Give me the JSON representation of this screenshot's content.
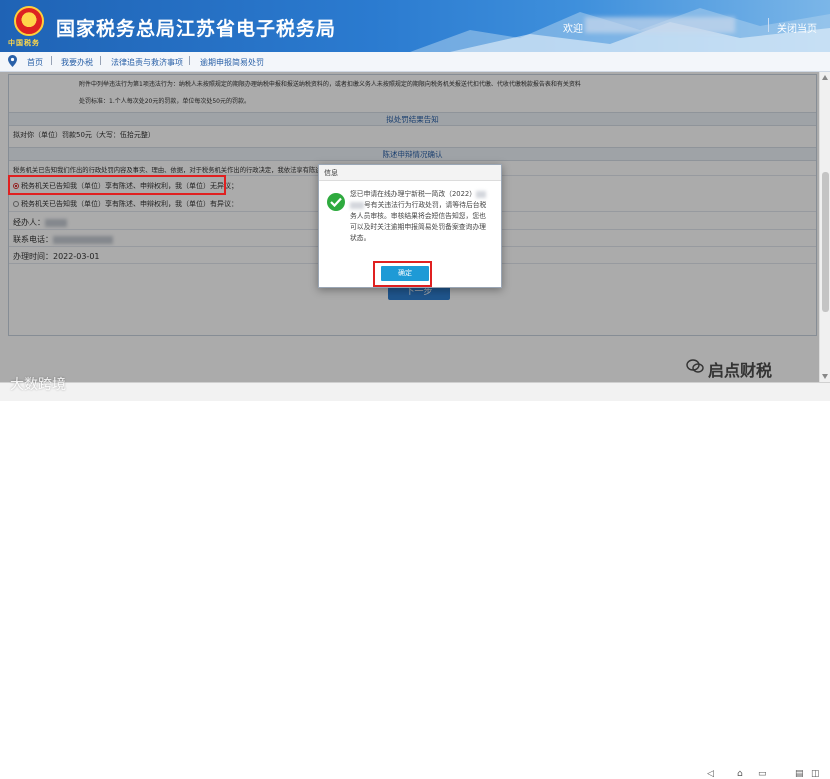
{
  "header": {
    "emblem_sub": "中国税务",
    "title": "国家税务总局江苏省电子税务局",
    "welcome": "欢迎",
    "close": "关闭当页"
  },
  "breadcrumb": [
    "首页",
    "我要办税",
    "法律追责与救济事项",
    "逾期申报简易处罚"
  ],
  "content": {
    "clause_line": "附件中列举违法行为第1项违法行为：纳税人未按照规定的期限办理纳税申报和报送纳税资料的，或者扣缴义务人未按照规定的期限向税务机关报送代扣代缴、代收代缴税款报告表和有关资料",
    "standard_line": "处罚标准：1.个人每次处20元的罚款，单位每次处50元的罚款。",
    "section_result": "拟处罚结果告知",
    "result_line": "拟对你（单位）罚款50元（大写：伍拾元整）",
    "section_confirm": "陈述申辩情况确认",
    "confirm_intro": "税务机关已告知我们作出的行政处罚内容及事实、理由、依据，对于税务机关作出的行政决定，我依法享有陈述、申辩权利：",
    "option1": "税务机关已告知我（单位）享有陈述、申辩权利，我（单位）无异议；",
    "option2": "税务机关已告知我（单位）享有陈述、申辩权利，我（单位）有异议：",
    "handler_label": "经办人：",
    "phone_label": "联系电话：",
    "date_label": "办理时间：",
    "date_value": "2022-03-01",
    "next_button": "下一步"
  },
  "dialog": {
    "title": "信息",
    "msg_part1": "您已申请在线办理宁新税一简改（2022）",
    "msg_part2": "号有关违法行为行政处罚，请等待后台税务人员审核。审核结果将会短信告知您，您也可以及时关注逾期申报简易处罚备案查询办理状态。",
    "ok_button": "确定"
  },
  "watermarks": {
    "left": "大数跨境",
    "right": "启点财税"
  }
}
